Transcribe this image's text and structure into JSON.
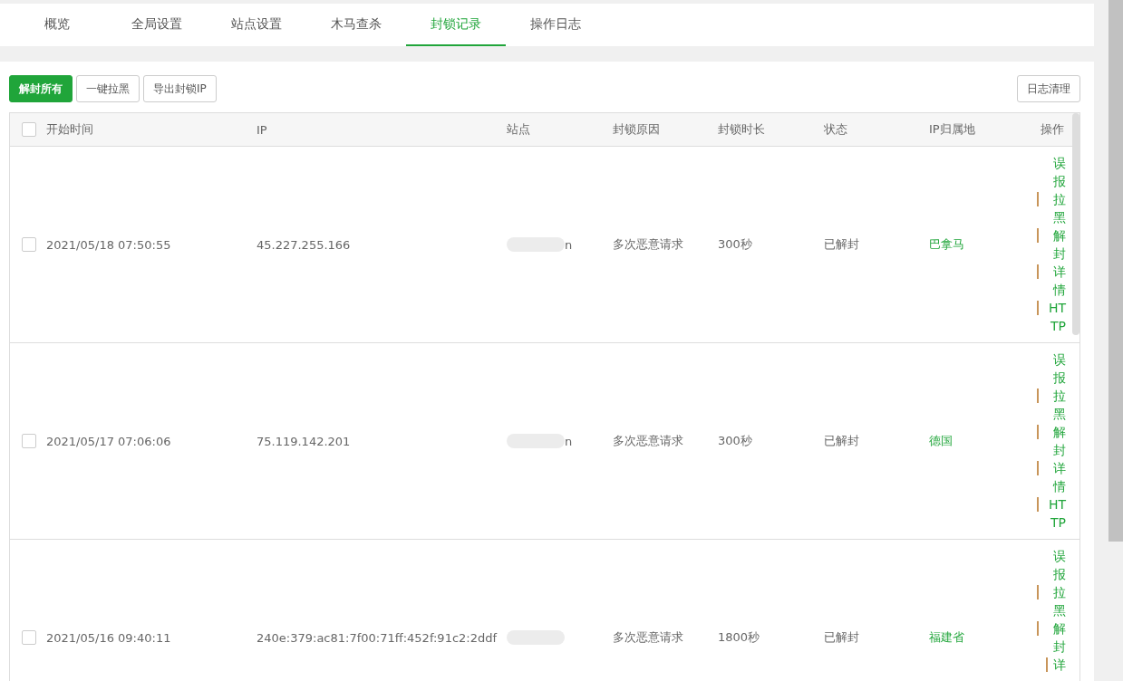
{
  "tabs": [
    {
      "label": "概览",
      "selected": false
    },
    {
      "label": "全局设置",
      "selected": false
    },
    {
      "label": "站点设置",
      "selected": false
    },
    {
      "label": "木马查杀",
      "selected": false
    },
    {
      "label": "封锁记录",
      "selected": true
    },
    {
      "label": "操作日志",
      "selected": false
    }
  ],
  "toolbar": {
    "buttons": [
      {
        "label": "解封所有",
        "kind": "primary"
      },
      {
        "label": "一键拉黑",
        "kind": "default"
      },
      {
        "label": "导出封锁IP",
        "kind": "default"
      }
    ],
    "right_button": "日志清理"
  },
  "table": {
    "select_all_checked": false,
    "columns": [
      "开始时间",
      "IP",
      "站点",
      "封锁原因",
      "封锁时长",
      "状态",
      "IP归属地",
      "操作"
    ],
    "rows": [
      {
        "checked": false,
        "start_time": "2021/05/18 07:50:55",
        "ip": "45.227.255.166",
        "site": "n",
        "reason": "多次恶意请求",
        "duration": "300秒",
        "status": "已解封",
        "location": "巴拿马",
        "actions": [
          "误报",
          "拉黑",
          "解封",
          "详情",
          "HTTP"
        ]
      },
      {
        "checked": false,
        "start_time": "2021/05/17 07:06:06",
        "ip": "75.119.142.201",
        "site": "n",
        "reason": "多次恶意请求",
        "duration": "300秒",
        "status": "已解封",
        "location": "德国",
        "actions": [
          "误报",
          "拉黑",
          "解封",
          "详情",
          "HTTP"
        ]
      },
      {
        "checked": false,
        "start_time": "2021/05/16 09:40:11",
        "ip": "240e:379:ac81:7f00:71ff:452f:91c2:2ddf",
        "site": "",
        "reason": "多次恶意请求",
        "duration": "1800秒",
        "status": "已解封",
        "location": "福建省",
        "actions": [
          "误报",
          "拉黑",
          "解封",
          "详"
        ]
      }
    ]
  }
}
